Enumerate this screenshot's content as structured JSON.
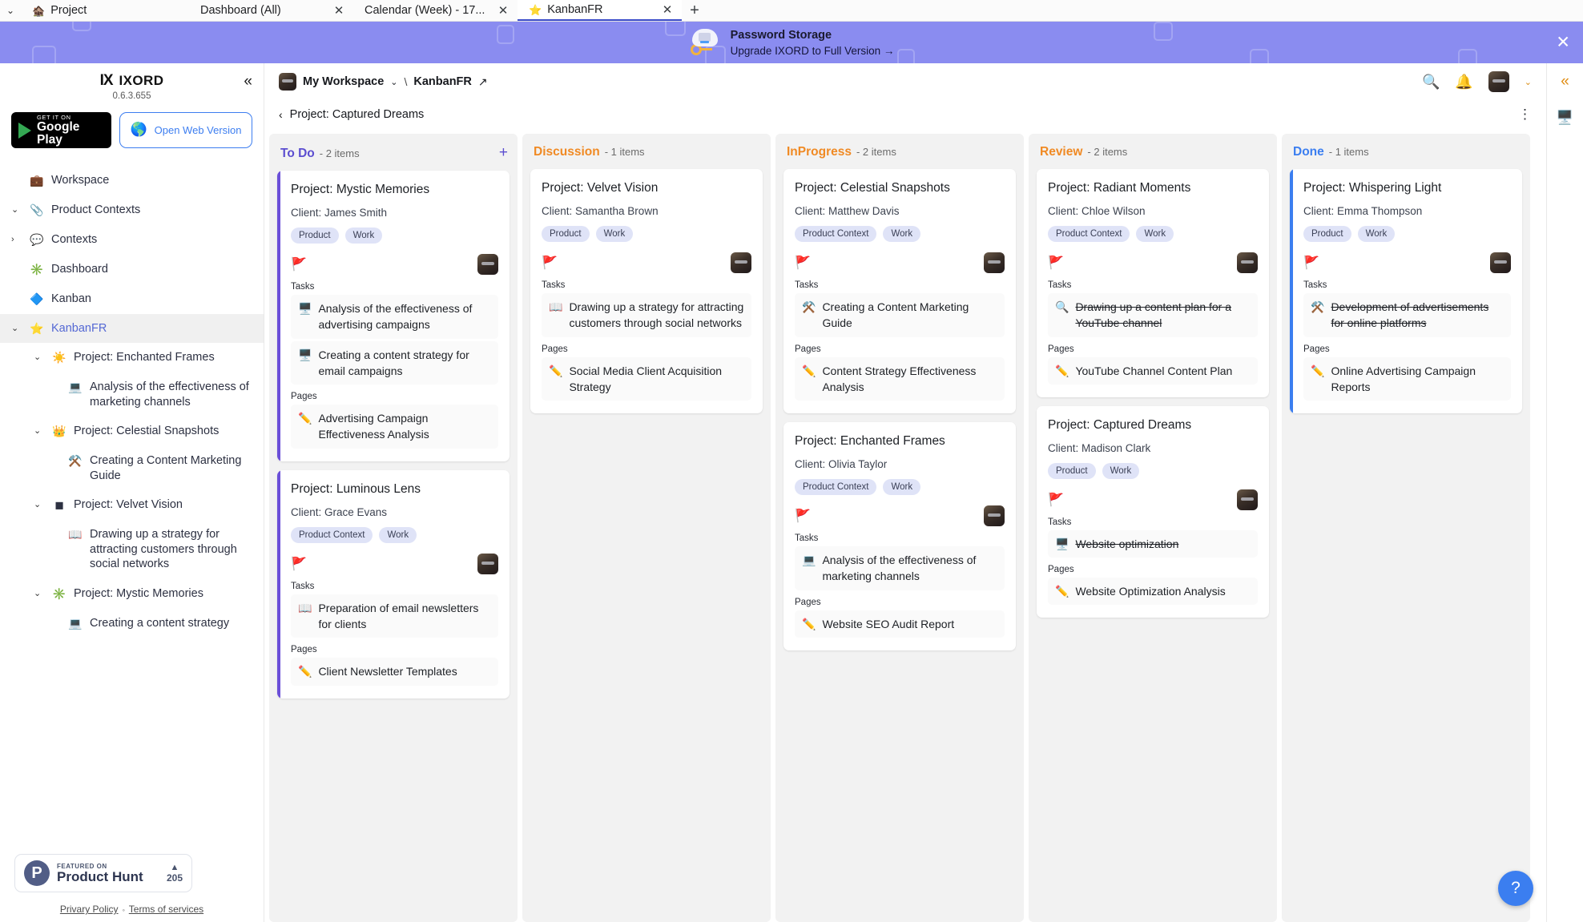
{
  "browser": {
    "tabs": [
      {
        "icon": "🏚️",
        "title": "Project",
        "close": "",
        "active": false,
        "has_close": false
      },
      {
        "icon": "",
        "title": "Dashboard (All)",
        "close": "✕",
        "active": false,
        "has_close": true
      },
      {
        "icon": "",
        "title": "Calendar (Week) - 17...",
        "close": "✕",
        "active": false,
        "has_close": true
      },
      {
        "icon": "⭐",
        "title": "KanbanFR",
        "close": "✕",
        "active": true,
        "has_close": true
      }
    ],
    "tab_list_caret": "⌄",
    "new_tab": "+"
  },
  "promo": {
    "title": "Password Storage",
    "subtitle": "Upgrade IXORD to Full Version  →",
    "close": "✕",
    "background": "#8a8cf0"
  },
  "sidebar": {
    "logo_mark": "IX",
    "brand": "IXORD",
    "version": "0.6.3.655",
    "collapse_icon": "«",
    "google_play": {
      "small": "GET IT ON",
      "big": "Google Play"
    },
    "web_version": {
      "icon": "🌎",
      "label": "Open Web Version"
    },
    "items": [
      {
        "caret": "",
        "icon": "💼",
        "label": "Workspace",
        "indent": 1,
        "active": false
      },
      {
        "caret": "⌄",
        "icon": "📎",
        "label": "Product Contexts",
        "indent": 0,
        "active": false
      },
      {
        "caret": "›",
        "icon": "💬",
        "label": "Contexts",
        "indent": 1,
        "active": false
      },
      {
        "caret": "",
        "icon": "✳️",
        "label": "Dashboard",
        "indent": 1,
        "active": false
      },
      {
        "caret": "",
        "icon": "🔷",
        "label": "Kanban",
        "indent": 1,
        "active": false
      },
      {
        "caret": "⌄",
        "icon": "⭐",
        "label": "KanbanFR",
        "indent": 1,
        "active": true
      },
      {
        "caret": "⌄",
        "icon": "☀️",
        "label": "Project: Enchanted Frames",
        "indent": 2,
        "active": false
      },
      {
        "caret": "",
        "icon": "💻",
        "label": "Analysis of the effectiveness of marketing channels",
        "indent": 3,
        "active": false
      },
      {
        "caret": "⌄",
        "icon": "👑",
        "label": "Project: Celestial Snapshots",
        "indent": 2,
        "active": false
      },
      {
        "caret": "",
        "icon": "⚒️",
        "label": "Creating a Content Marketing Guide",
        "indent": 3,
        "active": false
      },
      {
        "caret": "⌄",
        "icon": "◼",
        "label": "Project: Velvet Vision",
        "indent": 2,
        "active": false
      },
      {
        "caret": "",
        "icon": "📖",
        "label": "Drawing up a strategy for attracting customers through social networks",
        "indent": 3,
        "active": false
      },
      {
        "caret": "⌄",
        "icon": "✳️",
        "label": "Project: Mystic Memories",
        "indent": 2,
        "active": false
      },
      {
        "caret": "",
        "icon": "💻",
        "label": "Creating a content strategy",
        "indent": 3,
        "active": false
      }
    ],
    "product_hunt": {
      "featured": "FEATURED ON",
      "name": "Product Hunt",
      "arrow": "▲",
      "votes": "205",
      "logo": "P"
    },
    "footer": {
      "privacy": "Privary Policy",
      "dot": "◦",
      "terms": "Terms of services"
    }
  },
  "header": {
    "workspace": "My Workspace",
    "workspace_caret": "⌄",
    "separator": "\\",
    "board": "KanbanFR",
    "external_link_icon": "↗",
    "search_icon": "🔍",
    "bell_icon": "🔔",
    "avatar_caret": "⌄",
    "back_caret": "‹",
    "subtitle": "Project: Captured Dreams",
    "kebab": "⋮"
  },
  "rail": {
    "collapse_icon": "«",
    "monitor_icon": "🖥️"
  },
  "help_button": "?",
  "board": {
    "columns": [
      {
        "title": "To Do",
        "count": "- 2 items",
        "color": "#5c4ed0",
        "accent": "#6b4fd8",
        "add_icon": "+",
        "has_add": true,
        "cards": [
          {
            "title": "Project: Mystic Memories",
            "client": "Client: James Smith",
            "chips": [
              "Product",
              "Work"
            ],
            "flag": "🚩",
            "flag_color": "#1f8ae8",
            "tasks_label": "Tasks",
            "tasks": [
              {
                "icon": "🖥️",
                "text": "Analysis of the effectiveness of advertising campaigns",
                "done": false
              },
              {
                "icon": "🖥️",
                "text": "Creating a content strategy for email campaigns",
                "done": false
              }
            ],
            "pages_label": "Pages",
            "pages": [
              {
                "icon": "✏️",
                "text": "Advertising Campaign Effectiveness Analysis",
                "done": false
              }
            ]
          },
          {
            "title": "Project: Luminous Lens",
            "client": "Client: Grace Evans",
            "chips": [
              "Product Context",
              "Work"
            ],
            "flag": "🚩",
            "flag_color": "#1f8ae8",
            "tasks_label": "Tasks",
            "tasks": [
              {
                "icon": "📖",
                "text": "Preparation of email newsletters for clients",
                "done": false
              }
            ],
            "pages_label": "Pages",
            "pages": [
              {
                "icon": "✏️",
                "text": "Client Newsletter Templates",
                "done": false
              }
            ]
          }
        ]
      },
      {
        "title": "Discussion",
        "count": "- 1 items",
        "color": "#f08a24",
        "accent": "",
        "add_icon": "+",
        "has_add": false,
        "cards": [
          {
            "title": "Project: Velvet Vision",
            "client": "Client: Samantha Brown",
            "chips": [
              "Product",
              "Work"
            ],
            "flag": "🚩",
            "flag_color": "#34a853",
            "tasks_label": "Tasks",
            "tasks": [
              {
                "icon": "📖",
                "text": "Drawing up a strategy for attracting customers through social networks",
                "done": false
              }
            ],
            "pages_label": "Pages",
            "pages": [
              {
                "icon": "✏️",
                "text": "Social Media Client Acquisition Strategy",
                "done": false
              }
            ]
          }
        ]
      },
      {
        "title": "InProgress",
        "count": "- 2 items",
        "color": "#f08a24",
        "accent": "",
        "add_icon": "+",
        "has_add": false,
        "cards": [
          {
            "title": "Project: Celestial Snapshots",
            "client": "Client: Matthew Davis",
            "chips": [
              "Product Context",
              "Work"
            ],
            "flag": "🚩",
            "flag_color": "#ecc400",
            "tasks_label": "Tasks",
            "tasks": [
              {
                "icon": "⚒️",
                "text": "Creating a Content Marketing Guide",
                "done": false
              }
            ],
            "pages_label": "Pages",
            "pages": [
              {
                "icon": "✏️",
                "text": "Content Strategy Effectiveness Analysis",
                "done": false
              }
            ]
          },
          {
            "title": "Project: Enchanted Frames",
            "client": "Client: Olivia Taylor",
            "chips": [
              "Product Context",
              "Work"
            ],
            "flag": "🚩",
            "flag_color": "#ecc400",
            "tasks_label": "Tasks",
            "tasks": [
              {
                "icon": "💻",
                "text": "Analysis of the effectiveness of marketing channels",
                "done": false
              }
            ],
            "pages_label": "Pages",
            "pages": [
              {
                "icon": "✏️",
                "text": "Website SEO Audit Report",
                "done": false
              }
            ]
          }
        ]
      },
      {
        "title": "Review",
        "count": "- 2 items",
        "color": "#f08a24",
        "accent": "",
        "add_icon": "+",
        "has_add": false,
        "cards": [
          {
            "title": "Project: Radiant Moments",
            "client": "Client: Chloe Wilson",
            "chips": [
              "Product Context",
              "Work"
            ],
            "flag": "🚩",
            "flag_color": "#e8423a",
            "tasks_label": "Tasks",
            "tasks": [
              {
                "icon": "🔍",
                "text": "Drawing up a content plan for a YouTube channel",
                "done": true
              }
            ],
            "pages_label": "Pages",
            "pages": [
              {
                "icon": "✏️",
                "text": "YouTube Channel Content Plan",
                "done": false
              }
            ]
          },
          {
            "title": "Project: Captured Dreams",
            "client": "Client: Madison Clark",
            "chips": [
              "Product",
              "Work"
            ],
            "flag": "🚩",
            "flag_color": "#e8423a",
            "tasks_label": "Tasks",
            "tasks": [
              {
                "icon": "🖥️",
                "text": "Website optimization",
                "done": true
              }
            ],
            "pages_label": "Pages",
            "pages": [
              {
                "icon": "✏️",
                "text": "Website Optimization Analysis",
                "done": false
              }
            ]
          }
        ]
      },
      {
        "title": "Done",
        "count": "- 1 items",
        "color": "#3b7ef0",
        "accent": "#3b7ef0",
        "add_icon": "+",
        "has_add": false,
        "cards": [
          {
            "title": "Project: Whispering Light",
            "client": "Client: Emma Thompson",
            "chips": [
              "Product",
              "Work"
            ],
            "flag": "🚩",
            "flag_color": "#e8423a",
            "tasks_label": "Tasks",
            "tasks": [
              {
                "icon": "⚒️",
                "text": "Development of advertisements for online platforms",
                "done": true
              }
            ],
            "pages_label": "Pages",
            "pages": [
              {
                "icon": "✏️",
                "text": "Online Advertising Campaign Reports",
                "done": false
              }
            ]
          }
        ]
      }
    ]
  }
}
